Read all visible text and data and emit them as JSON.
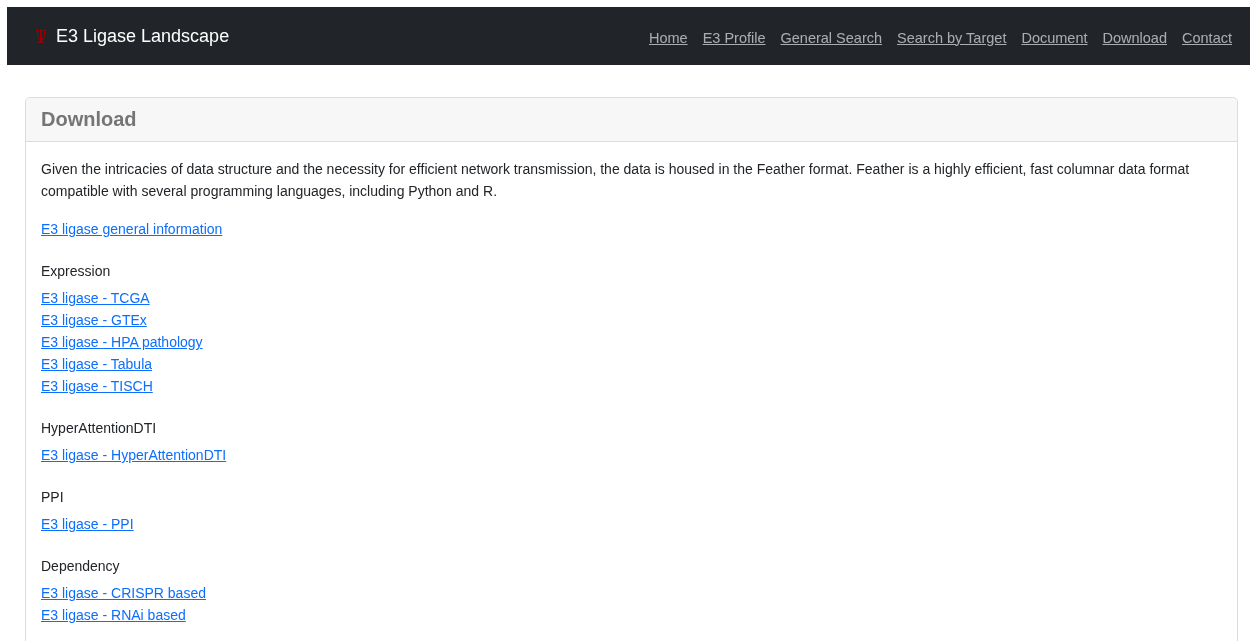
{
  "navbar": {
    "brand": "E3 Ligase Landscape",
    "links": [
      "Home",
      "E3 Profile",
      "General Search",
      "Search by Target",
      "Document",
      "Download",
      "Contact"
    ]
  },
  "card": {
    "title": "Download",
    "intro": "Given the intricacies of data structure and the necessity for efficient network transmission, the data is housed in the Feather format. Feather is a highly efficient, fast columnar data format compatible with several programming languages, including Python and R.",
    "sections": [
      {
        "links": [
          "E3 ligase general information"
        ]
      },
      {
        "heading": "Expression",
        "links": [
          "E3 ligase - TCGA",
          "E3 ligase - GTEx",
          "E3 ligase - HPA pathology",
          "E3 ligase - Tabula",
          "E3 ligase - TISCH"
        ]
      },
      {
        "heading": "HyperAttentionDTI",
        "links": [
          "E3 ligase - HyperAttentionDTI"
        ]
      },
      {
        "heading": "PPI",
        "links": [
          "E3 ligase - PPI"
        ]
      },
      {
        "heading": "Dependency",
        "links": [
          "E3 ligase - CRISPR based",
          "E3 ligase - RNAi based"
        ]
      }
    ]
  }
}
